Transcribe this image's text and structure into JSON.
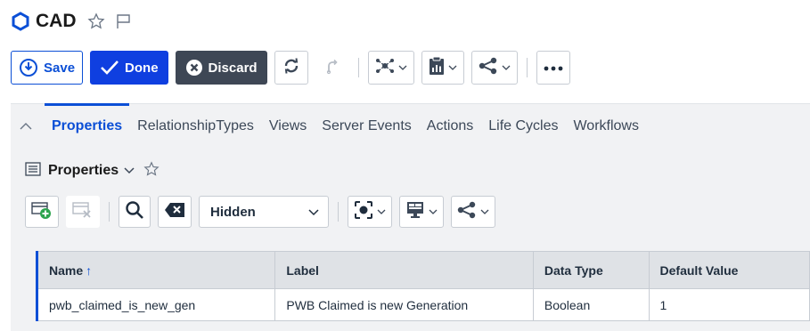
{
  "header": {
    "title": "CAD"
  },
  "toolbar": {
    "save_label": "Save",
    "done_label": "Done",
    "discard_label": "Discard"
  },
  "tabs": [
    {
      "label": "Properties",
      "active": true
    },
    {
      "label": "RelationshipTypes"
    },
    {
      "label": "Views"
    },
    {
      "label": "Server Events"
    },
    {
      "label": "Actions"
    },
    {
      "label": "Life Cycles"
    },
    {
      "label": "Workflows"
    }
  ],
  "panel": {
    "title": "Properties",
    "select_value": "Hidden"
  },
  "grid": {
    "columns": [
      "Name",
      "Label",
      "Data Type",
      "Default Value"
    ],
    "sort_indicator": "↑",
    "rows": [
      [
        "pwb_claimed_is_new_gen",
        "PWB Claimed is new Generation",
        "Boolean",
        "1"
      ]
    ]
  },
  "colors": {
    "accent": "#0b4fd6",
    "done_bg": "#0f3fe0",
    "discard_bg": "#3e4755",
    "panel_bg": "#f1f2f4"
  }
}
